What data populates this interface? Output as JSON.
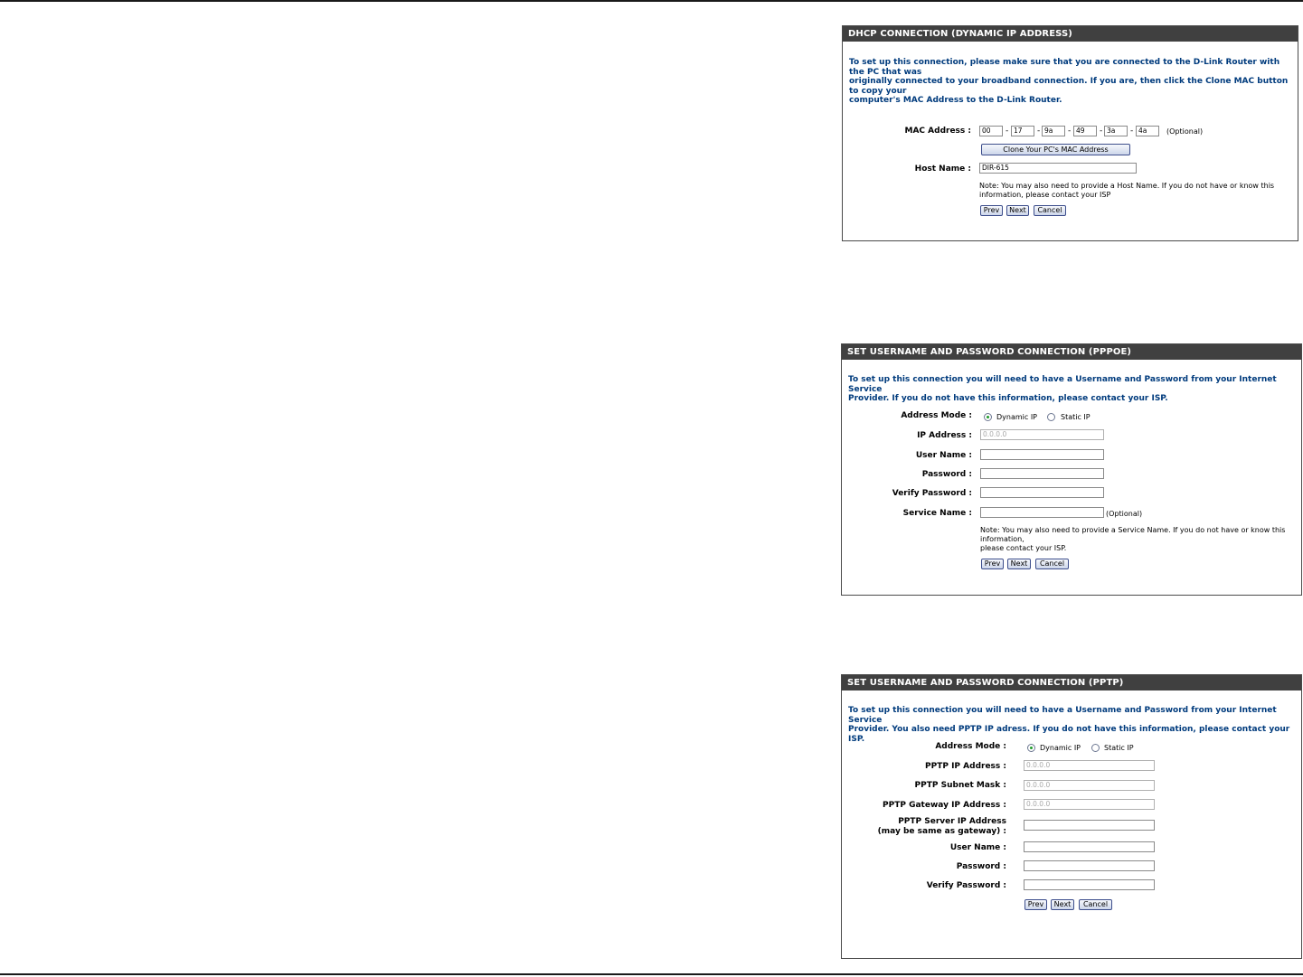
{
  "dhcp": {
    "title": "DHCP CONNECTION (DYNAMIC IP ADDRESS)",
    "intro": "To set up this connection, please make sure that you are connected to the D-Link Router with the PC that was\noriginally connected to your broadband connection. If you are, then click the Clone MAC button to copy your\ncomputer's MAC Address to the D-Link Router.",
    "mac_label": "MAC Address :",
    "mac": [
      "00",
      "17",
      "9a",
      "49",
      "3a",
      "4a"
    ],
    "mac_sep": "-",
    "optional": "(Optional)",
    "clone_button": "Clone Your PC's MAC Address",
    "host_label": "Host Name :",
    "host_value": "DIR-615",
    "note": "Note: You may also need to provide a Host Name. If you do not have or know this\ninformation, please contact your ISP",
    "prev": "Prev",
    "next": "Next",
    "cancel": "Cancel"
  },
  "pppoe": {
    "title": "SET USERNAME AND PASSWORD CONNECTION (PPPOE)",
    "intro": "To set up this connection you will need to have a Username and Password from your Internet Service\nProvider. If you do not have this information, please contact your ISP.",
    "address_mode_label": "Address Mode :",
    "dynamic_ip": "Dynamic IP",
    "static_ip": "Static IP",
    "selected_mode": "Dynamic IP",
    "ip_label": "IP Address :",
    "ip_value": "0.0.0.0",
    "user_label": "User Name :",
    "password_label": "Password :",
    "verify_label": "Verify Password :",
    "service_label": "Service Name :",
    "optional": "(Optional)",
    "note": "Note: You may also need to provide a Service Name. If you do not have or know this\ninformation,\nplease contact your ISP.",
    "prev": "Prev",
    "next": "Next",
    "cancel": "Cancel"
  },
  "pptp": {
    "title": "SET USERNAME AND PASSWORD CONNECTION (PPTP)",
    "intro": "To set up this connection you will need to have a Username and Password from your Internet Service\nProvider. You also need PPTP IP adress. If you do not have this information, please contact your ISP.",
    "address_mode_label": "Address Mode :",
    "dynamic_ip": "Dynamic IP",
    "static_ip": "Static IP",
    "selected_mode": "Dynamic IP",
    "ip_label": "PPTP IP Address :",
    "ip_value": "0.0.0.0",
    "subnet_label": "PPTP Subnet Mask :",
    "subnet_value": "0.0.0.0",
    "gateway_label": "PPTP Gateway IP Address :",
    "gateway_value": "0.0.0.0",
    "server_label": "PPTP Server IP Address\n(may be same as gateway) :",
    "user_label": "User Name :",
    "password_label": "Password :",
    "verify_label": "Verify Password :",
    "prev": "Prev",
    "next": "Next",
    "cancel": "Cancel"
  }
}
